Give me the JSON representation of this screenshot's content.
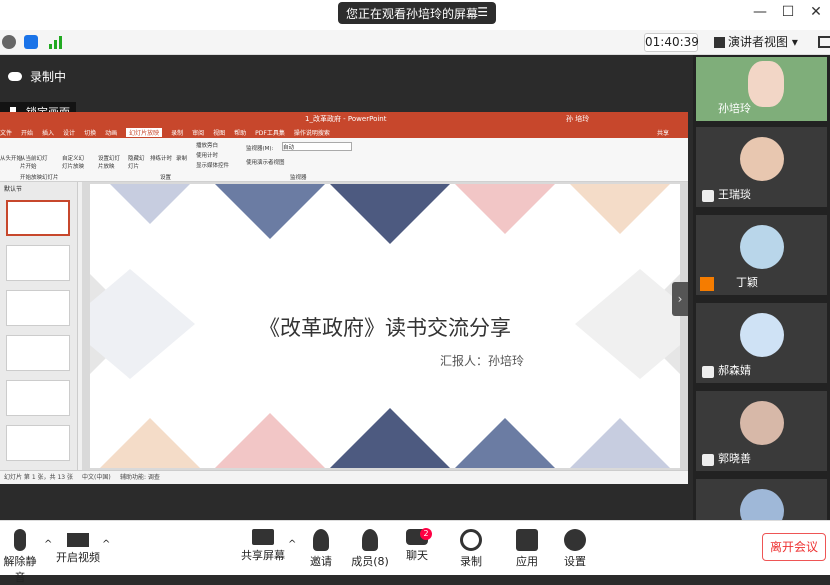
{
  "top": {
    "share_text": "您正在观看孙培玲的屏幕",
    "menu_glyph": "☰",
    "min": "—",
    "max": "☐",
    "close": "✕"
  },
  "toolbar": {
    "clock": "01:40:39",
    "view_label": "演讲者视图",
    "view_arrow": "▾"
  },
  "recording": {
    "label": "录制中"
  },
  "lock": {
    "label": "锁定画面"
  },
  "ppt": {
    "window_title": "1_改革政府 - PowerPoint",
    "user": "孙 培玲",
    "tabs": [
      "文件",
      "开始",
      "插入",
      "设计",
      "切换",
      "动画",
      "幻灯片放映",
      "录制",
      "审阅",
      "视图",
      "帮助",
      "PDF工具集",
      "操作说明搜索"
    ],
    "active_tab": "幻灯片放映",
    "share": "共享",
    "ribbon": {
      "group1": "开始放映幻灯片",
      "b1": "从头开始",
      "b2": "从当前幻灯片开始",
      "b3": "自定义幻灯片放映",
      "group2": "设置",
      "b4": "设置幻灯片放映",
      "b5": "隐藏幻灯片",
      "b6": "排练计时",
      "b7": "录制",
      "c1": "播放旁白",
      "c2": "使用计时",
      "c3": "显示媒体控件",
      "group3": "监视器",
      "monitor_label": "监视器(M):",
      "monitor_value": "自动",
      "c4": "使用演示者视图"
    },
    "section": "默认节",
    "slide_title": "《改革政府》读书交流分享",
    "slide_sub": "汇报人：孙培玲",
    "status_left": "幻灯片 第 1 张，共 13 张",
    "status_lang": "中文(中国)",
    "status_acc": "辅助功能: 调查"
  },
  "participants": [
    {
      "name": "孙培玲",
      "color": "#f2d6c6"
    },
    {
      "name": "王瑞琰",
      "color": "#e8c7b0"
    },
    {
      "name": "丁颖",
      "color": "#b9d6ea"
    },
    {
      "name": "郝森婧",
      "color": "#cfe2f5"
    },
    {
      "name": "郭晓善",
      "color": "#d7b8a8"
    }
  ],
  "bottom": {
    "unmute": "解除静音",
    "video": "开启视频",
    "share": "共享屏幕",
    "invite": "邀请",
    "members": "成员(8)",
    "chat": "聊天",
    "chat_badge": "2",
    "record": "录制",
    "apps": "应用",
    "settings": "设置",
    "leave": "离开会议",
    "caret": "^"
  },
  "colors": {
    "ppt_red": "#c7472c",
    "leave_red": "#e33"
  }
}
